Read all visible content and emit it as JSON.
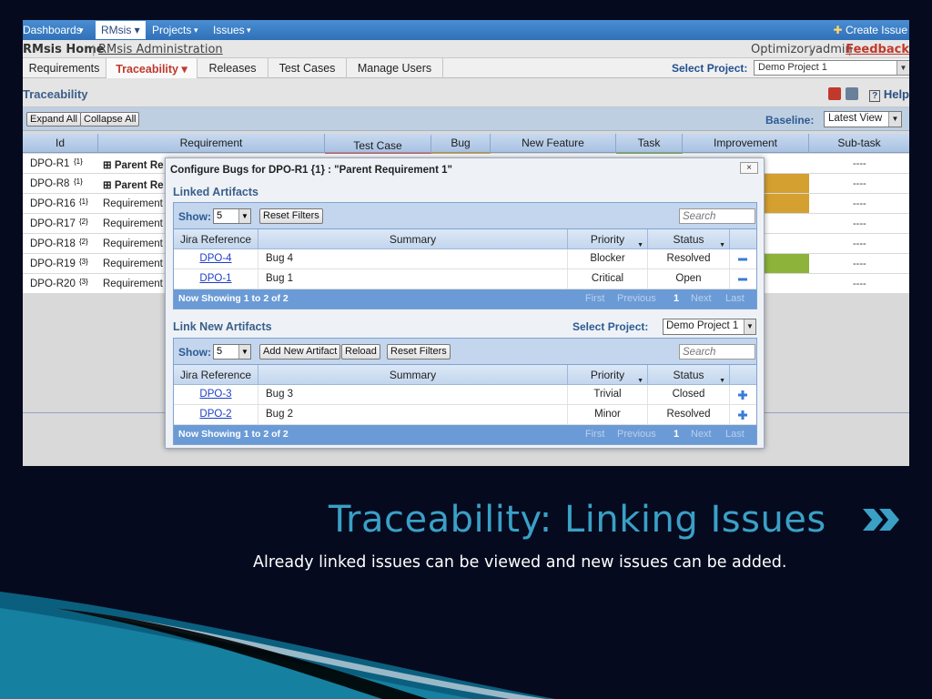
{
  "colors": {
    "slide_bg": "#050a1e",
    "title_color": "#3aa0c6",
    "bug_header": "#d9534f",
    "feature_header": "#e0a020",
    "task_header": "#7aac36"
  },
  "jira_nav": {
    "items": [
      "Dashboards",
      "RMsis",
      "Projects",
      "Issues"
    ],
    "create_issue": "Create Issue"
  },
  "rmsis_bar": {
    "home": "RMsis Home",
    "admin": "RMsis Administration",
    "right": [
      "Optimizory",
      "admin"
    ],
    "feedback": "Feedback"
  },
  "tabs": {
    "items": [
      "Requirements",
      "Traceability",
      "Releases",
      "Test Cases",
      "Manage Users"
    ],
    "active": "Traceability",
    "select_project_label": "Select Project:",
    "select_project_value": "Demo Project 1"
  },
  "page": {
    "title": "Traceability",
    "help": "Help"
  },
  "toolbar": {
    "expand_all": "Expand All",
    "collapse_all": "Collapse All",
    "baseline_label": "Baseline:",
    "baseline_value": "Latest View"
  },
  "grid": {
    "headers": [
      "Id",
      "Requirement",
      "Test Case",
      "Bug",
      "New Feature",
      "Task",
      "Improvement",
      "Sub-task"
    ],
    "rows": [
      {
        "id": "DPO-R1",
        "ver": "{1}",
        "req": "⊞ Parent Re",
        "bold": true,
        "sub": "----"
      },
      {
        "id": "DPO-R8",
        "ver": "{1}",
        "req": "⊞ Parent Re",
        "bold": true,
        "sub": "----"
      },
      {
        "id": "DPO-R16",
        "ver": "{1}",
        "req": "Requirement",
        "bold": false,
        "sub": "----"
      },
      {
        "id": "DPO-R17",
        "ver": "{2}",
        "req": "Requirement",
        "bold": false,
        "sub": "----"
      },
      {
        "id": "DPO-R18",
        "ver": "{2}",
        "req": "Requirement",
        "bold": false,
        "sub": "----"
      },
      {
        "id": "DPO-R19",
        "ver": "{3}",
        "req": "Requirement",
        "bold": false,
        "sub": "----"
      },
      {
        "id": "DPO-R20",
        "ver": "{3}",
        "req": "Requirement",
        "bold": false,
        "sub": "----"
      }
    ]
  },
  "dialog": {
    "title": "Configure Bugs for DPO-R1 {1} : \"Parent Requirement 1\"",
    "close": "×",
    "linked": {
      "section": "Linked Artifacts",
      "show_label": "Show:",
      "show_value": "5",
      "reset_filters": "Reset Filters",
      "search_placeholder": "Search",
      "headers": [
        "Jira Reference",
        "Summary",
        "Priority",
        "Status"
      ],
      "rows": [
        {
          "ref": "DPO-4",
          "summary": "Bug 4",
          "priority": "Blocker",
          "status": "Resolved"
        },
        {
          "ref": "DPO-1",
          "summary": "Bug 1",
          "priority": "Critical",
          "status": "Open"
        }
      ],
      "footer": "Now Showing 1 to 2 of 2",
      "pager": [
        "First",
        "Previous",
        "1",
        "Next",
        "Last"
      ]
    },
    "link_new": {
      "section": "Link New Artifacts",
      "select_project_label": "Select Project:",
      "select_project_value": "Demo Project 1",
      "show_label": "Show:",
      "show_value": "5",
      "add_new": "Add New Artifact",
      "reload": "Reload",
      "reset_filters": "Reset Filters",
      "search_placeholder": "Search",
      "headers": [
        "Jira Reference",
        "Summary",
        "Priority",
        "Status"
      ],
      "rows": [
        {
          "ref": "DPO-3",
          "summary": "Bug 3",
          "priority": "Trivial",
          "status": "Closed"
        },
        {
          "ref": "DPO-2",
          "summary": "Bug 2",
          "priority": "Minor",
          "status": "Resolved"
        }
      ],
      "footer": "Now Showing 1 to 2 of 2",
      "pager": [
        "First",
        "Previous",
        "1",
        "Next",
        "Last"
      ]
    }
  },
  "slide": {
    "title": "Traceability: Linking Issues",
    "subtitle": "Already linked issues can be viewed and new issues can be added."
  }
}
